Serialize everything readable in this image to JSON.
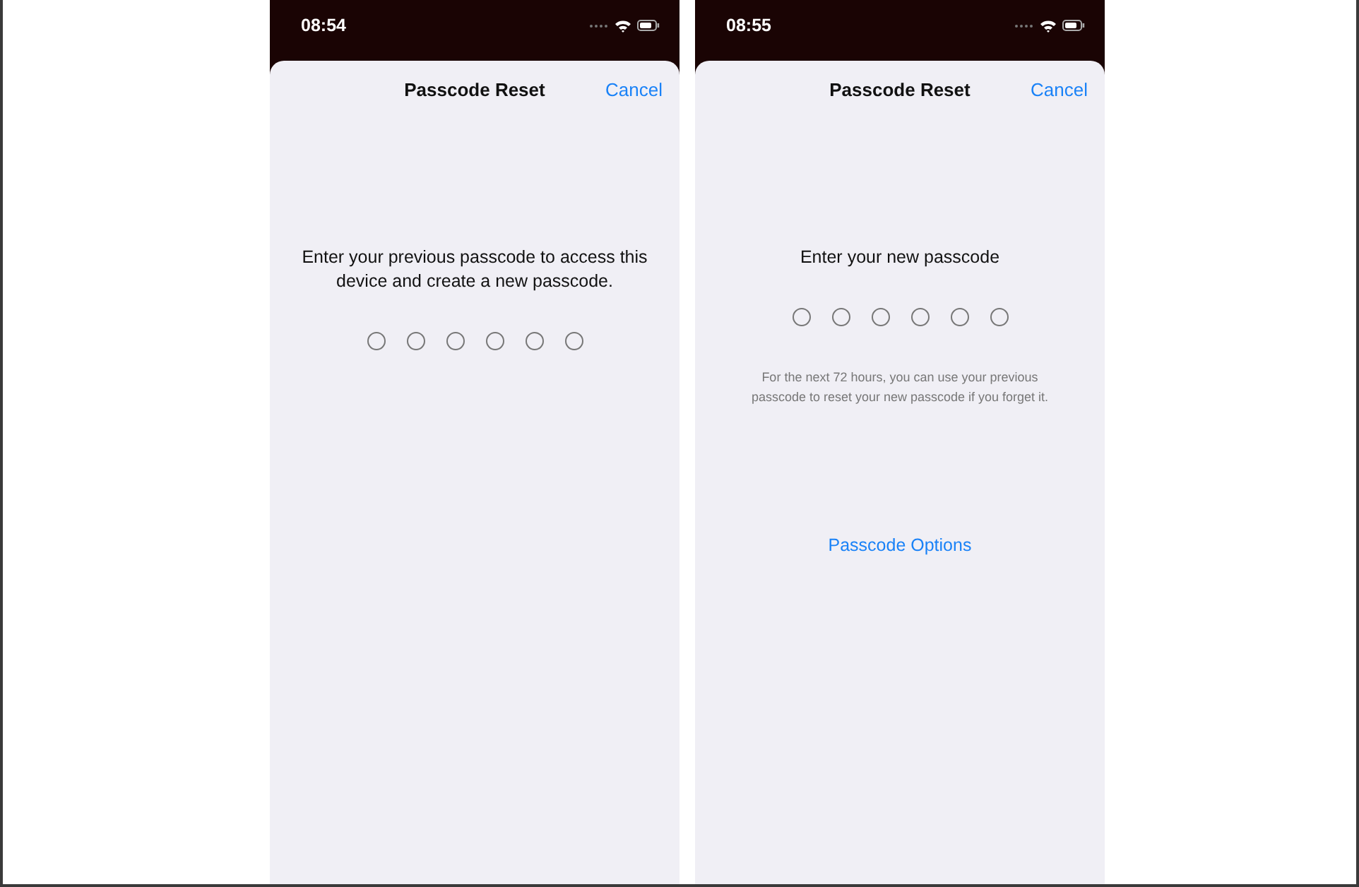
{
  "screens": [
    {
      "status_bar": {
        "time": "08:54"
      },
      "title": "Passcode Reset",
      "cancel": "Cancel",
      "prompt": "Enter your previous passcode to access this device and create a new passcode.",
      "passcode_dots": [
        {
          "filled": false
        },
        {
          "filled": false
        },
        {
          "filled": false
        },
        {
          "filled": false
        },
        {
          "filled": false
        },
        {
          "filled": false
        }
      ]
    },
    {
      "status_bar": {
        "time": "08:55"
      },
      "title": "Passcode Reset",
      "cancel": "Cancel",
      "prompt": "Enter your new passcode",
      "passcode_dots": [
        {
          "filled": false
        },
        {
          "filled": false
        },
        {
          "filled": false
        },
        {
          "filled": false
        },
        {
          "filled": false
        },
        {
          "filled": false
        }
      ],
      "note": "For the next 72 hours, you can use your previous passcode to reset your new passcode if you forget it.",
      "options_link": "Passcode Options"
    }
  ]
}
